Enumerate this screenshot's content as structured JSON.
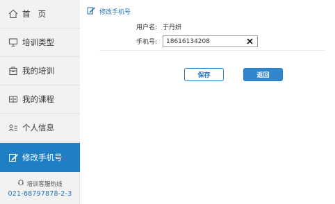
{
  "sidebar": {
    "items": [
      {
        "label": "首页",
        "icon": "home-icon"
      },
      {
        "label": "培训类型",
        "icon": "monitor-icon"
      },
      {
        "label": "我的培训",
        "icon": "briefcase-icon"
      },
      {
        "label": "我的课程",
        "icon": "book-icon"
      },
      {
        "label": "个人信息",
        "icon": "user-list-icon"
      },
      {
        "label": "修改手机号",
        "icon": "edit-icon",
        "active": true
      }
    ],
    "hotline": {
      "title": "培训客服热线",
      "phone": "021-68797878-2-3"
    }
  },
  "main": {
    "header": "修改手机号",
    "username_label": "用户名:",
    "username_value": "于丹妍",
    "phone_label": "手机号:",
    "phone_value": "18616134208",
    "save_label": "保存",
    "back_label": "返回"
  },
  "colors": {
    "accent": "#1e7fc5",
    "sidebar_bg": "#f2f2f2",
    "link_blue": "#1e6fb5"
  }
}
